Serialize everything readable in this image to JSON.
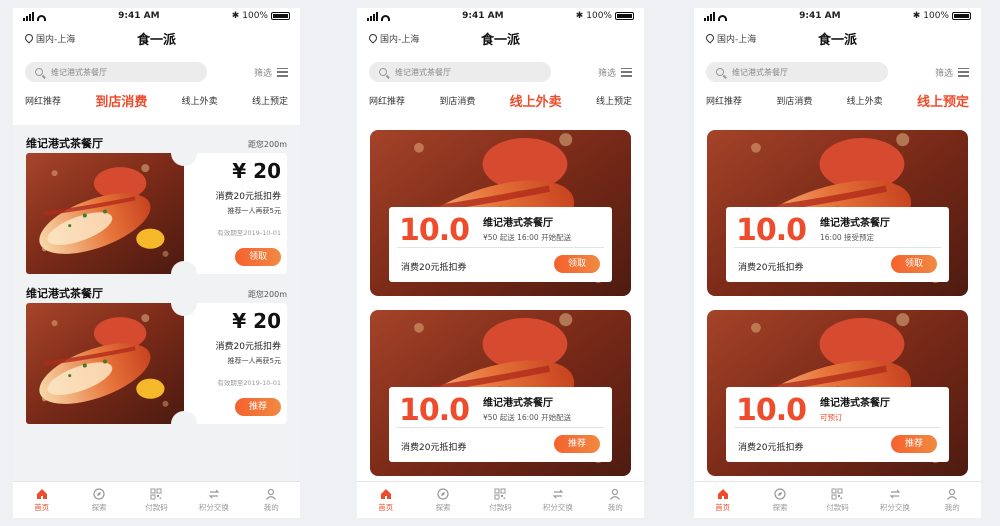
{
  "status": {
    "time": "9:41 AM",
    "battery": "100%"
  },
  "header": {
    "location": "国内-上海",
    "title": "食一派"
  },
  "search": {
    "placeholder": "维记港式茶餐厅",
    "filter_label": "筛选"
  },
  "tabs": [
    "网红推荐",
    "到店消费",
    "线上外卖",
    "线上预定"
  ],
  "screens": [
    {
      "active_tab": 1,
      "tickets": [
        {
          "name": "维记港式茶餐厅",
          "distance": "距您200m",
          "price": "¥ 20",
          "desc": "消费20元抵扣券",
          "sub": "推荐一人再获5元",
          "valid": "有效期至2019-10-01",
          "button": "领取"
        },
        {
          "name": "维记港式茶餐厅",
          "distance": "距您200m",
          "price": "¥ 20",
          "desc": "消费20元抵扣券",
          "sub": "推荐一人再获5元",
          "valid": "有效期至2019-10-01",
          "button": "推荐"
        }
      ]
    },
    {
      "active_tab": 2,
      "cards": [
        {
          "score": "10.0",
          "name": "维记港式茶餐厅",
          "meta": "¥50 起送      16:00 开始配送",
          "coupon": "消费20元抵扣券",
          "button": "领取"
        },
        {
          "score": "10.0",
          "name": "维记港式茶餐厅",
          "meta": "¥50 起送      16:00 开始配送",
          "coupon": "消费20元抵扣券",
          "button": "推荐"
        }
      ]
    },
    {
      "active_tab": 3,
      "cards": [
        {
          "score": "10.0",
          "name": "维记港式茶餐厅",
          "meta": "16:00 接受预定",
          "coupon": "消费20元抵扣券",
          "button": "领取"
        },
        {
          "score": "10.0",
          "name": "维记港式茶餐厅",
          "meta": "可预订",
          "coupon": "消费20元抵扣券",
          "button": "推荐"
        }
      ]
    }
  ],
  "tabbar": [
    {
      "label": "首页",
      "icon": "home-icon"
    },
    {
      "label": "探索",
      "icon": "compass-icon"
    },
    {
      "label": "付款码",
      "icon": "qr-code-icon"
    },
    {
      "label": "积分交换",
      "icon": "exchange-icon"
    },
    {
      "label": "我的",
      "icon": "user-icon"
    }
  ],
  "colors": {
    "accent": "#ee4d2d",
    "button_start": "#f5612e",
    "button_end": "#f08a42"
  }
}
